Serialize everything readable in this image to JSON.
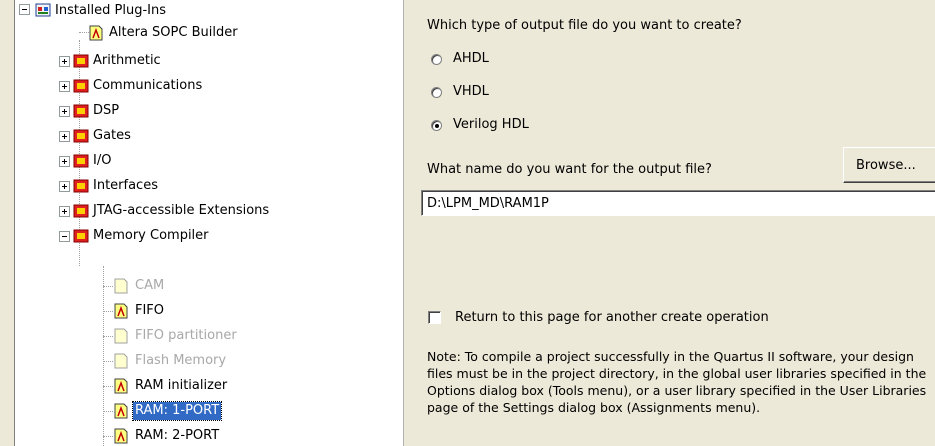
{
  "tree": {
    "root": {
      "label": "Installed Plug-Ins"
    },
    "items": [
      {
        "label": "Altera SOPC Builder",
        "icon": "plugin-file-icon"
      },
      {
        "label": "Arithmetic",
        "icon": "folder-icon"
      },
      {
        "label": "Communications",
        "icon": "folder-icon"
      },
      {
        "label": "DSP",
        "icon": "folder-icon"
      },
      {
        "label": "Gates",
        "icon": "folder-icon"
      },
      {
        "label": "I/O",
        "icon": "folder-icon"
      },
      {
        "label": "Interfaces",
        "icon": "folder-icon"
      },
      {
        "label": "JTAG-accessible Extensions",
        "icon": "folder-icon"
      },
      {
        "label": "Memory Compiler",
        "icon": "folder-icon"
      }
    ],
    "memory_children": [
      {
        "label": "CAM",
        "state": "disabled"
      },
      {
        "label": "FIFO",
        "state": "enabled"
      },
      {
        "label": "FIFO partitioner",
        "state": "disabled"
      },
      {
        "label": "Flash Memory",
        "state": "disabled"
      },
      {
        "label": "RAM initializer",
        "state": "enabled"
      },
      {
        "label": "RAM: 1-PORT",
        "state": "selected"
      },
      {
        "label": "RAM: 2-PORT",
        "state": "enabled"
      }
    ]
  },
  "output_type": {
    "question": "Which type of output file do you want to create?",
    "options": [
      {
        "label": "AHDL",
        "selected": false
      },
      {
        "label": "VHDL",
        "selected": false
      },
      {
        "label": "Verilog HDL",
        "selected": true
      }
    ]
  },
  "output_name": {
    "question": "What name do you want for the output file?",
    "value": "D:\\LPM_MD\\RAM1P",
    "browse_label": "Browse..."
  },
  "return_checkbox": {
    "label": "Return to this page for another create operation",
    "checked": false
  },
  "note": "Note: To compile a project successfully in the Quartus II software, your design files must be in the project directory, in the global user libraries specified in the Options dialog box (Tools menu), or a user library specified in the User Libraries page of the Settings dialog box (Assignments menu)."
}
